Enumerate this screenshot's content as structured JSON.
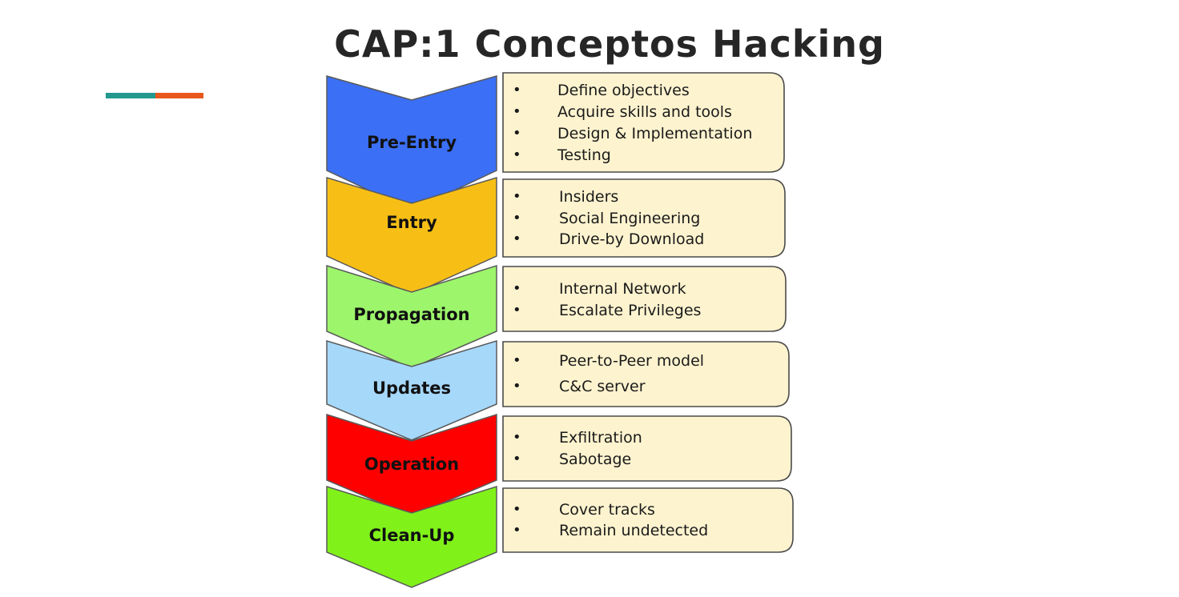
{
  "title": "CAP:1 Conceptos Hacking",
  "accent_colors": {
    "teal": "#23998e",
    "orange": "#e8571c"
  },
  "box_fill": "#fdf3cf",
  "stages": [
    {
      "label": "Pre-Entry",
      "color": "#3b6ff5",
      "items": [
        "Define objectives",
        "Acquire skills and tools",
        "Design & Implementation",
        "Testing"
      ]
    },
    {
      "label": "Entry",
      "color": "#f7bf16",
      "items": [
        "Insiders",
        "Social Engineering",
        "Drive-by Download"
      ]
    },
    {
      "label": "Propagation",
      "color": "#9cf56b",
      "items": [
        "Internal Network",
        "Escalate Privileges"
      ]
    },
    {
      "label": "Updates",
      "color": "#a6d8fa",
      "items": [
        "Peer-to-Peer model",
        "C&C server"
      ]
    },
    {
      "label": "Operation",
      "color": "#ff0000",
      "items": [
        "Exfiltration",
        "Sabotage"
      ]
    },
    {
      "label": "Clean-Up",
      "color": "#80f21a",
      "items": [
        "Cover tracks",
        "Remain undetected"
      ]
    }
  ]
}
